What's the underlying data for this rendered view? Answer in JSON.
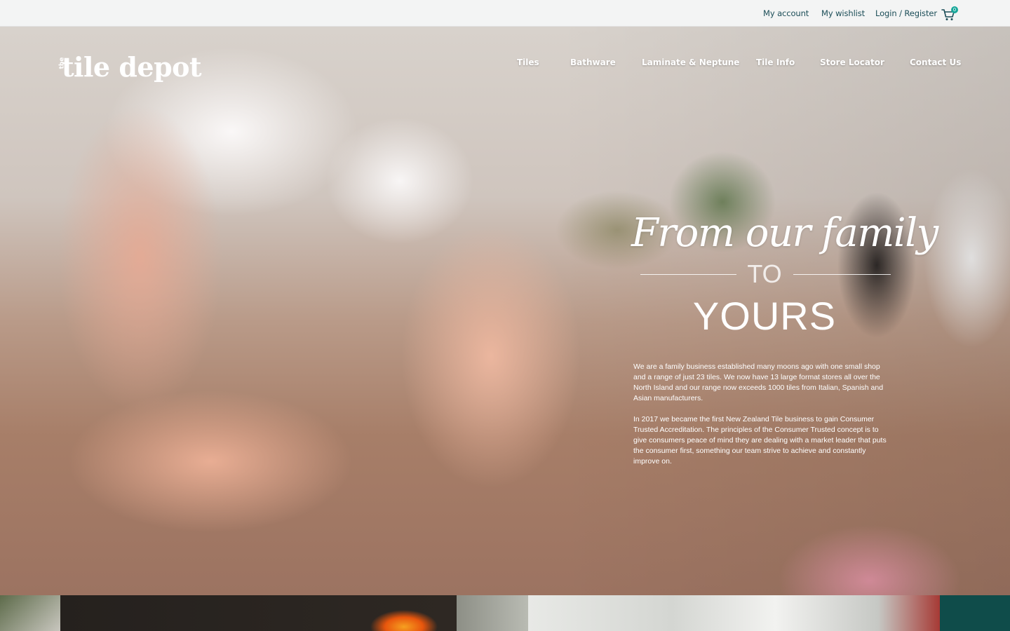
{
  "topbar": {
    "my_account": "My account",
    "my_wishlist": "My wishlist",
    "login_register": "Login / Register",
    "cart_count": "0"
  },
  "brand": {
    "prefix": "the",
    "name": "tile depot"
  },
  "nav": {
    "items": [
      {
        "label": "Tiles"
      },
      {
        "label": "Bathware"
      },
      {
        "label": "Laminate & Neptune"
      },
      {
        "label": "Tile Info"
      },
      {
        "label": "Store Locator"
      },
      {
        "label": "Contact Us"
      }
    ]
  },
  "hero": {
    "script_line": "From our family",
    "connector": "TO",
    "big_word": "YOURS",
    "paragraphs": [
      "We are a family business established many moons ago with one small shop and a range of just 23 tiles. We now have 13 large format stores all over the North Island and our range now exceeds 1000 tiles from Italian, Spanish and Asian manufacturers.",
      "In 2017 we became the first New Zealand Tile business to gain Consumer Trusted Accreditation. The principles of the Consumer Trusted concept is to give consumers peace of mind they are dealing with a market leader that puts the consumer first, something our team strive to achieve and constantly improve on."
    ]
  },
  "colors": {
    "accent": "#17a79a",
    "topbar_bg": "#f3f4f4",
    "link_text": "#1b4d57",
    "teal_panel": "#0f4c4a"
  },
  "icons": {
    "cart": "cart-icon"
  }
}
